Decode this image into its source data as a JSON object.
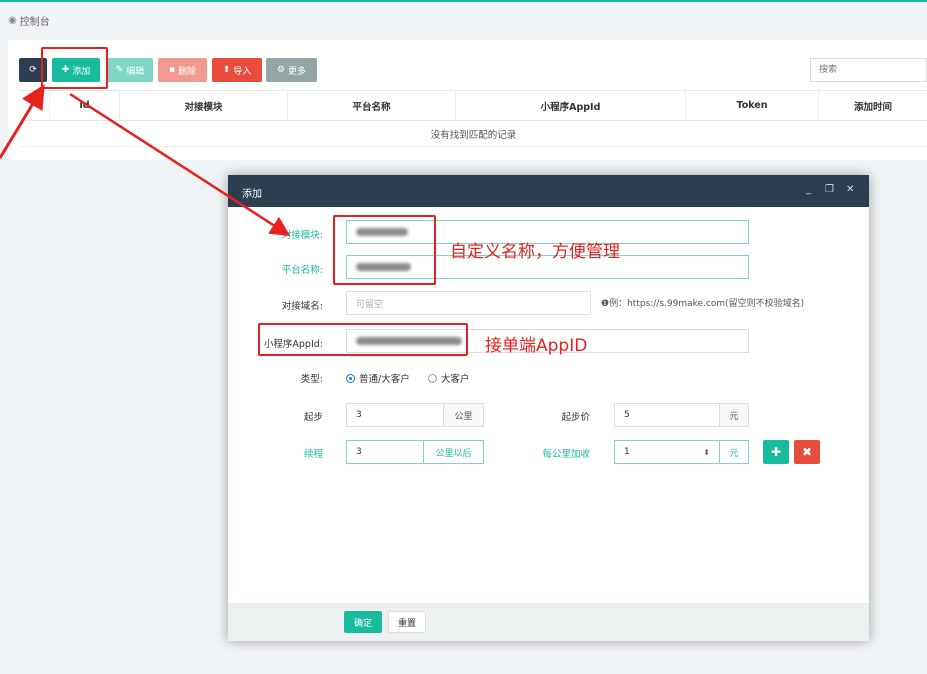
{
  "breadcrumb": {
    "icon": "dashboard-icon",
    "label": "控制台"
  },
  "toolbar": {
    "add_label": "添加",
    "edit_label": "编辑",
    "delete_label": "删除",
    "import_label": "导入",
    "more_label": "更多"
  },
  "search": {
    "placeholder": "搜索"
  },
  "table": {
    "columns": [
      "Id",
      "对接模块",
      "平台名称",
      "小程序AppId",
      "Token",
      "添加时间"
    ],
    "empty_text": "没有找到匹配的记录"
  },
  "modal": {
    "title": "添加",
    "fields": {
      "module_label": "对接模块:",
      "platform_label": "平台名称:",
      "domain_label": "对接域名:",
      "domain_placeholder": "可留空",
      "domain_hint": "例：https://s.99make.com(留空则不校验域名)",
      "appid_label": "小程序AppId:",
      "type_label": "类型:",
      "type_option_normal": "普通/大客户",
      "type_option_big": "大客户",
      "start_label": "起步",
      "start_value": "3",
      "start_unit": "公里",
      "start_price_label": "起步价",
      "start_price_value": "5",
      "start_price_unit": "元",
      "continue_label": "续程",
      "continue_value": "3",
      "continue_unit": "公里以后",
      "per_km_label": "每公里加收",
      "per_km_value": "1",
      "per_km_unit": "元"
    },
    "footer": {
      "ok_label": "确定",
      "reset_label": "重置"
    }
  },
  "annotations": {
    "name_note": "自定义名称，方便管理",
    "appid_note": "接单端AppID"
  },
  "colors": {
    "primary": "#18bc9c",
    "dark": "#2c3e50",
    "danger": "#e74c3c",
    "annotation_red": "#e8211f"
  }
}
